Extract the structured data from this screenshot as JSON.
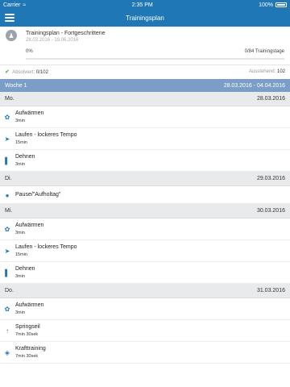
{
  "status": {
    "carrier": "Carrier",
    "time": "2:35 PM",
    "battery": "100%"
  },
  "nav": {
    "title": "Trainingsplan"
  },
  "plan": {
    "name": "Trainingsplan - Fortgeschrittene",
    "dates": "28.03.2016 - 19.06.2016",
    "percent": "0%",
    "days": "0/84 Trainingstage",
    "progress": 0
  },
  "stats": {
    "done_label": "Absolviert:",
    "done_value": "0/102",
    "open_label": "Ausstehend:",
    "open_value": "102"
  },
  "week": {
    "label": "Woche 1",
    "range": "28.03.2016 - 04.04.2016"
  },
  "days": [
    {
      "day": "Mo.",
      "date": "28.03.2016",
      "items": [
        {
          "icon": "warmup-icon",
          "title": "Aufwärmen",
          "dur": "3min"
        },
        {
          "icon": "running-icon",
          "title": "Laufen - lockeres Tempo",
          "dur": "15min"
        },
        {
          "icon": "stretching-icon",
          "title": "Dehnen",
          "dur": "3min"
        }
      ]
    },
    {
      "day": "Di.",
      "date": "29.03.2016",
      "items": [
        {
          "icon": "rest-icon",
          "title": "Pause/\"Aufholtag\"",
          "dur": ""
        }
      ]
    },
    {
      "day": "Mi.",
      "date": "30.03.2016",
      "items": [
        {
          "icon": "warmup-icon",
          "title": "Aufwärmen",
          "dur": "3min"
        },
        {
          "icon": "running-icon",
          "title": "Laufen - lockeres Tempo",
          "dur": "15min"
        },
        {
          "icon": "stretching-icon",
          "title": "Dehnen",
          "dur": "3min"
        }
      ]
    },
    {
      "day": "Do.",
      "date": "31.03.2016",
      "items": [
        {
          "icon": "warmup-icon",
          "title": "Aufwärmen",
          "dur": "3min"
        },
        {
          "icon": "jumprope-icon",
          "title": "Springseil",
          "dur": "7min 30sek"
        },
        {
          "icon": "strength-icon",
          "title": "Krafttraining",
          "dur": "7min 30sek"
        }
      ]
    }
  ]
}
